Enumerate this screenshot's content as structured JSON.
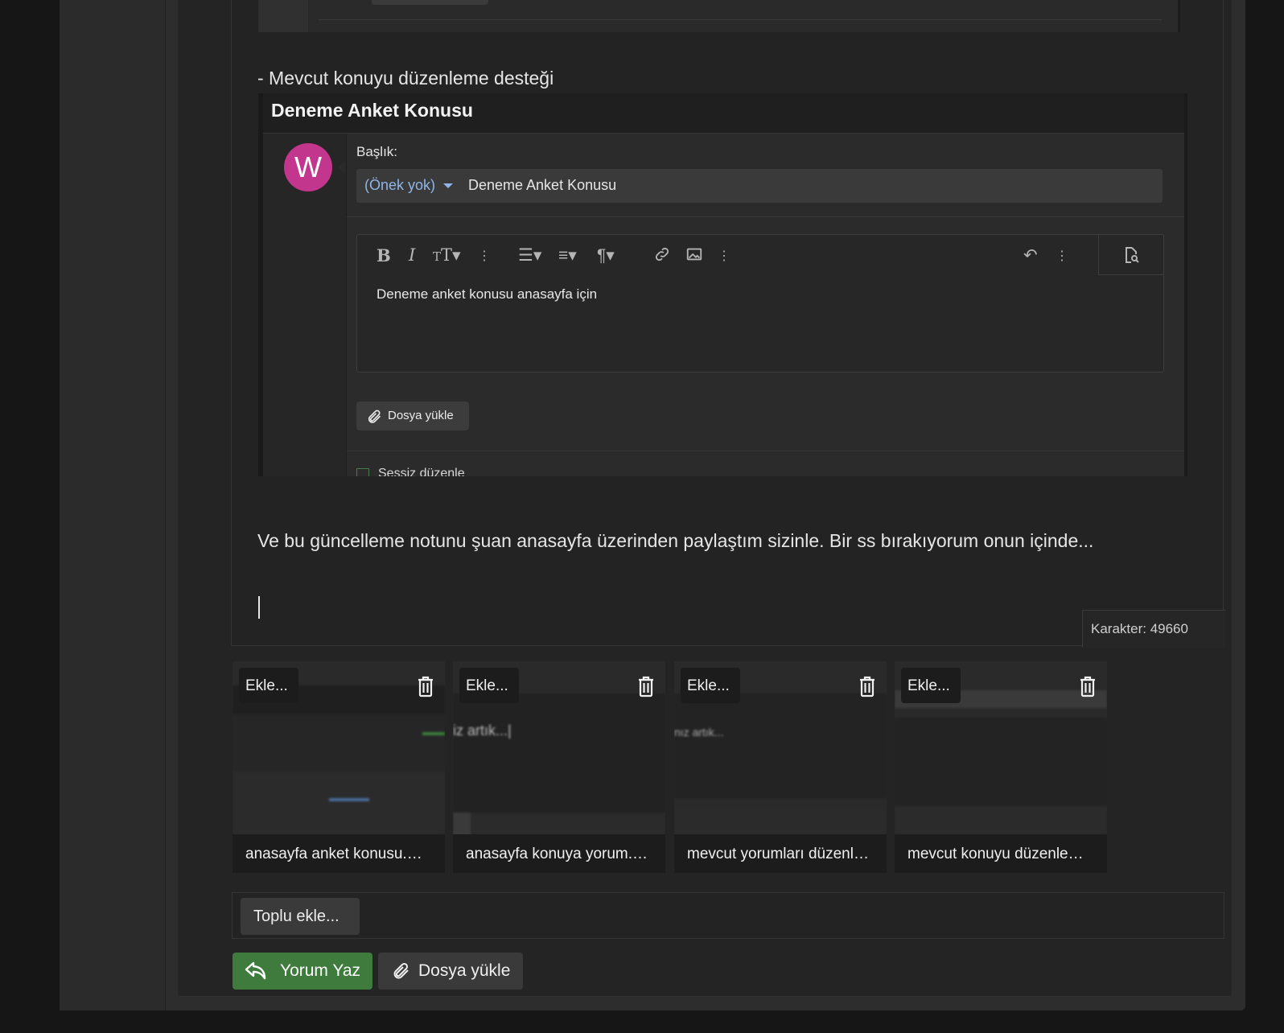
{
  "content": {
    "bullet_line": "- Mevcut konuyu düzenleme desteği",
    "body_text": "Ve bu güncelleme notunu şuan anasayfa üzerinden paylaştım sizinle. Bir ss bırakıyorum onun içinde...",
    "char_count": "Karakter: 49660"
  },
  "embedded_screenshot": {
    "thread_title": "Deneme Anket Konusu",
    "avatar_letter": "W",
    "title_label": "Başlık:",
    "prefix_value": "(Önek yok)",
    "title_value": "Deneme Anket Konusu",
    "editor_content": "Deneme anket konusu anasayfa için",
    "upload_button": "Dosya yükle",
    "silent_edit_label": "Sessiz düzenle",
    "toolbar_icons": [
      "bold-icon",
      "italic-icon",
      "font-size-icon",
      "more-icon",
      "list-icon",
      "align-icon",
      "paragraph-icon",
      "link-icon",
      "image-icon",
      "more-icon",
      "undo-icon",
      "more-icon",
      "preview-icon"
    ]
  },
  "attachments": [
    {
      "insert_label": "Ekle...",
      "caption": "anasayfa anket konusu.…"
    },
    {
      "insert_label": "Ekle...",
      "caption": "anasayfa konuya yorum.…"
    },
    {
      "insert_label": "Ekle...",
      "caption": "mevcut yorumları düzenl…"
    },
    {
      "insert_label": "Ekle...",
      "caption": "mevcut konuyu düzenle…"
    }
  ],
  "actions": {
    "bulk_insert": "Toplu ekle...",
    "reply_button": "Yorum Yaz",
    "upload_button": "Dosya yükle"
  },
  "colors": {
    "avatar": "#c2378d",
    "reply_button": "#3e7b3c",
    "prefix_link": "#8fb6e6"
  }
}
